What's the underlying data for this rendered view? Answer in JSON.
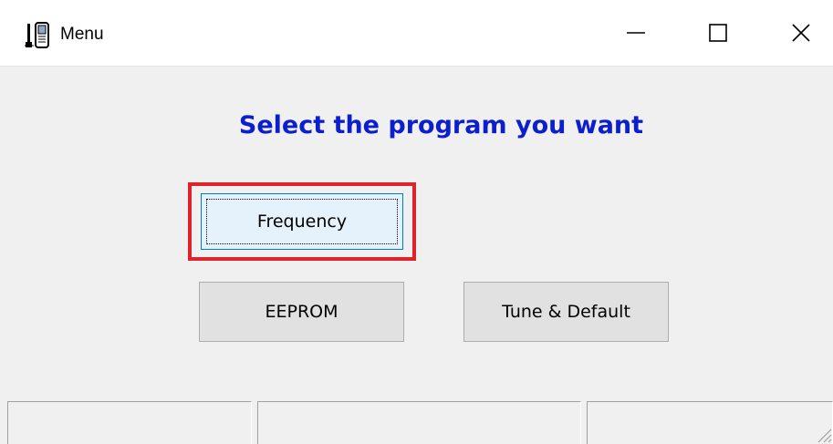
{
  "window": {
    "title": "Menu",
    "app_icon": "walkie-talkie-icon",
    "controls": {
      "minimize": "minimize-icon",
      "maximize": "maximize-icon",
      "close": "close-icon"
    }
  },
  "main": {
    "heading": "Select the program you want",
    "heading_color": "#0b1fcf",
    "buttons": {
      "frequency": "Frequency",
      "eeprom": "EEPROM",
      "tune_default": "Tune & Default"
    },
    "highlight_color": "#e0232a"
  },
  "statusbar": {
    "panels": [
      "",
      "",
      ""
    ]
  }
}
